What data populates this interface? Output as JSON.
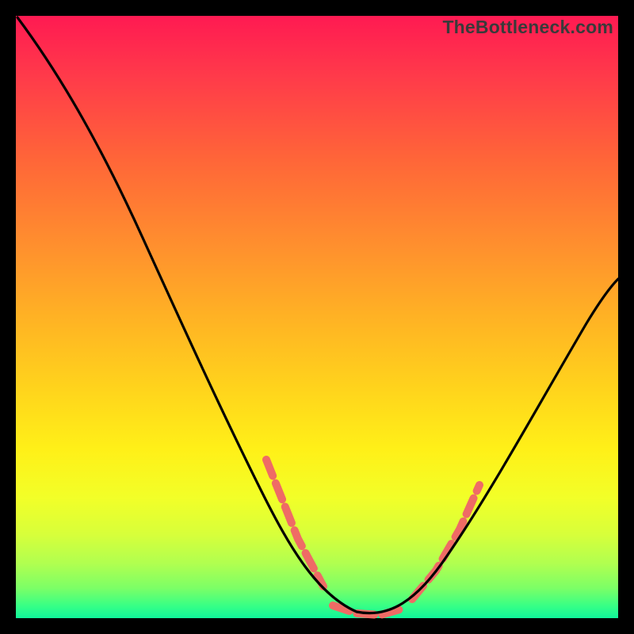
{
  "watermark": "TheBottleneck.com",
  "chart_data": {
    "type": "line",
    "title": "",
    "xlabel": "",
    "ylabel": "",
    "xlim": [
      0,
      100
    ],
    "ylim": [
      0,
      100
    ],
    "series": [
      {
        "name": "curve",
        "x": [
          0,
          6,
          12,
          18,
          24,
          30,
          36,
          42,
          47,
          50,
          52,
          55,
          58,
          60,
          63,
          67,
          72,
          78,
          85,
          92,
          100
        ],
        "values": [
          100,
          92,
          83,
          73,
          62,
          51,
          40,
          28,
          17,
          10,
          6,
          3,
          1,
          0,
          1,
          4,
          10,
          19,
          31,
          44,
          56
        ]
      }
    ],
    "highlight_band_x": [
      42,
      72
    ],
    "highlight_color": "#ef6b65",
    "curve_color": "#000000",
    "gradient_stops": [
      {
        "pos": 0,
        "color": "#ff1a52"
      },
      {
        "pos": 50,
        "color": "#ffb224"
      },
      {
        "pos": 80,
        "color": "#f2ff28"
      },
      {
        "pos": 100,
        "color": "#10f59a"
      }
    ]
  }
}
